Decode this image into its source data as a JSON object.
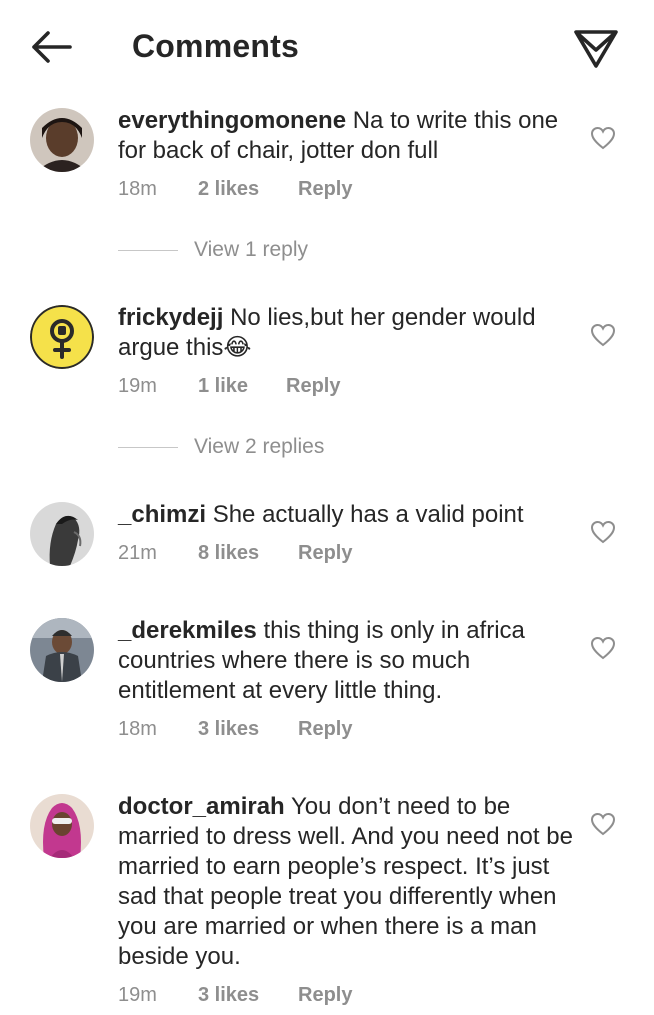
{
  "header": {
    "title": "Comments",
    "back_icon": "arrow-left-icon",
    "send_icon": "paper-plane-icon"
  },
  "comments": [
    {
      "username": "everythingomonene",
      "text": "Na to write this one for back of chair, jotter don full",
      "time": "18m",
      "likes": "2 likes",
      "reply": "Reply",
      "view_replies": "View 1 reply"
    },
    {
      "username": "frickydejj",
      "text": "No lies,but her gender would argue this😂",
      "time": "19m",
      "likes": "1 like",
      "reply": "Reply",
      "view_replies": "View 2 replies"
    },
    {
      "username": "_chimzi",
      "text": "She actually has a valid point",
      "time": "21m",
      "likes": "8 likes",
      "reply": "Reply"
    },
    {
      "username": "_derekmiles",
      "text": "this thing is only in africa countries where there is so much entitlement at every little thing.",
      "time": "18m",
      "likes": "3 likes",
      "reply": "Reply"
    },
    {
      "username": "doctor_amirah",
      "text": "You don’t need to be married to dress well. And you need not be married to earn people’s respect. It’s just sad that people treat you differently when you are married or when there is a man beside you.",
      "time": "19m",
      "likes": "3 likes",
      "reply": "Reply"
    }
  ],
  "colors": {
    "text": "#262626",
    "secondary": "#8e8e8e",
    "divider": "#c7c7c7",
    "avatar_yellow": "#f5e14a"
  }
}
